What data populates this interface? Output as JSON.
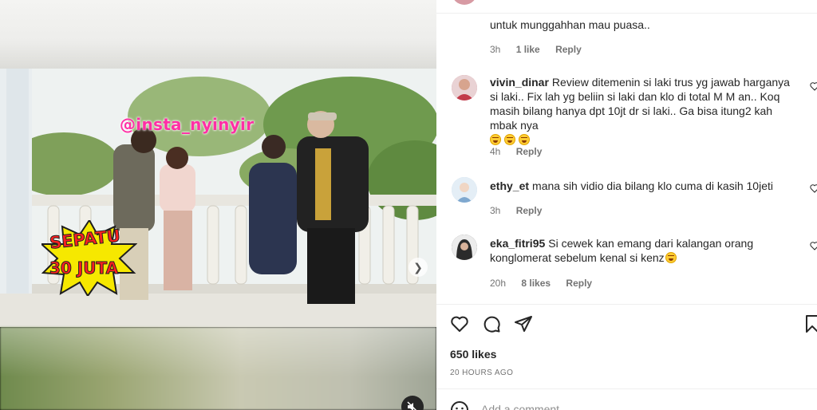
{
  "media": {
    "watermark": "@insta_nyinyir",
    "badge_line1": "SEPATU",
    "badge_line2": "30 JUTA",
    "next_icon": "chevron-right-icon",
    "mute_icon": "speaker-muted-icon"
  },
  "comments": {
    "partial": {
      "line": "untuk munggahhan mau puasa..",
      "time": "3h",
      "likes": "1 like",
      "reply": "Reply"
    },
    "items": [
      {
        "username": "vivin_dinar",
        "text": "Review ditemenin si laki trus yg jawab harganya si laki.. Fix lah yg beliin si laki dan klo di total M M an.. Koq masih bilang hanya dpt 10jt dr si laki.. Ga bisa itung2 kah mbak nya",
        "emoji_count": 3,
        "time": "4h",
        "likes": "",
        "reply": "Reply",
        "avatar_color": "#c97b86"
      },
      {
        "username": "ethy_et",
        "text": "mana sih vidio dia bilang klo cuma di kasih 10jeti",
        "emoji_count": 0,
        "time": "3h",
        "likes": "",
        "reply": "Reply",
        "avatar_color": "#b8d0e6"
      },
      {
        "username": "eka_fitri95",
        "text": "Si cewek kan emang dari kalangan orang konglomerat sebelum kenal si kenz",
        "emoji_count": 1,
        "time": "20h",
        "likes": "8 likes",
        "reply": "Reply",
        "avatar_color": "#3a3a3a"
      }
    ]
  },
  "actions": {
    "like_icon": "heart-icon",
    "comment_icon": "comment-bubble-icon",
    "share_icon": "send-paper-plane-icon",
    "save_icon": "bookmark-icon"
  },
  "post": {
    "likes": "650 likes",
    "time_ago": "20 HOURS AGO"
  },
  "add_comment": {
    "placeholder": "Add a comment...",
    "emoji_icon": "smiley-icon"
  }
}
